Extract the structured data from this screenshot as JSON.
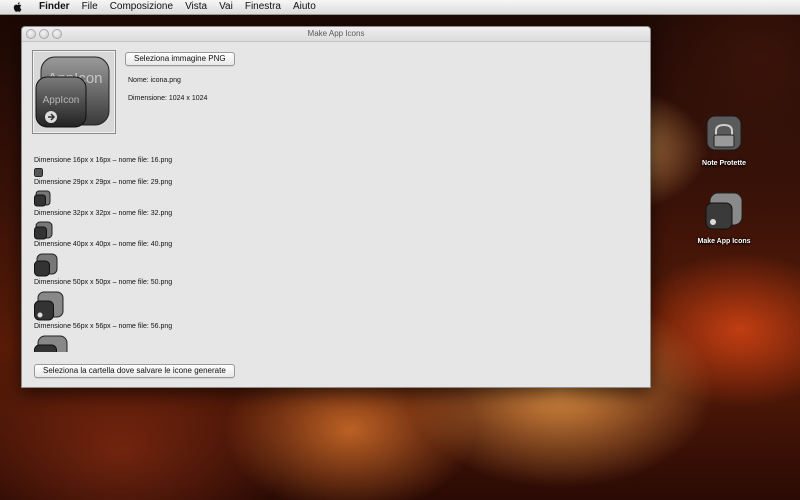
{
  "menubar": {
    "items": [
      "Finder",
      "File",
      "Composizione",
      "Vista",
      "Vai",
      "Finestra",
      "Aiuto"
    ]
  },
  "window": {
    "title": "Make App Icons",
    "select_png_button": "Seleziona immagine PNG",
    "file_name": "Nome: icona.png",
    "file_dimension": "Dimensione: 1024 x 1024",
    "preview_text": "AppIcon",
    "sizes": [
      {
        "label": "Dimensione 16px x 16px – nome file: 16.png"
      },
      {
        "label": "Dimensione 29px x 29px – nome file: 29.png"
      },
      {
        "label": "Dimensione 32px x 32px – nome file: 32.png"
      },
      {
        "label": "Dimensione 40px x 40px – nome file: 40.png"
      },
      {
        "label": "Dimensione 50px x 50px – nome file: 50.png"
      },
      {
        "label": "Dimensione 56px x 56px – nome file: 56.png"
      }
    ],
    "select_folder_button": "Seleziona la cartella dove salvare le icone generate"
  },
  "desktop": {
    "icons": [
      {
        "label": "Note Protette",
        "icon": "notes-lock-icon"
      },
      {
        "label": "Make App Icons",
        "icon": "app-icon"
      }
    ]
  },
  "colors": {
    "window_bg": "#e6e6e6",
    "menubar_bg": "#e8e8e8",
    "desktop_accent": "#ff8a3a"
  }
}
